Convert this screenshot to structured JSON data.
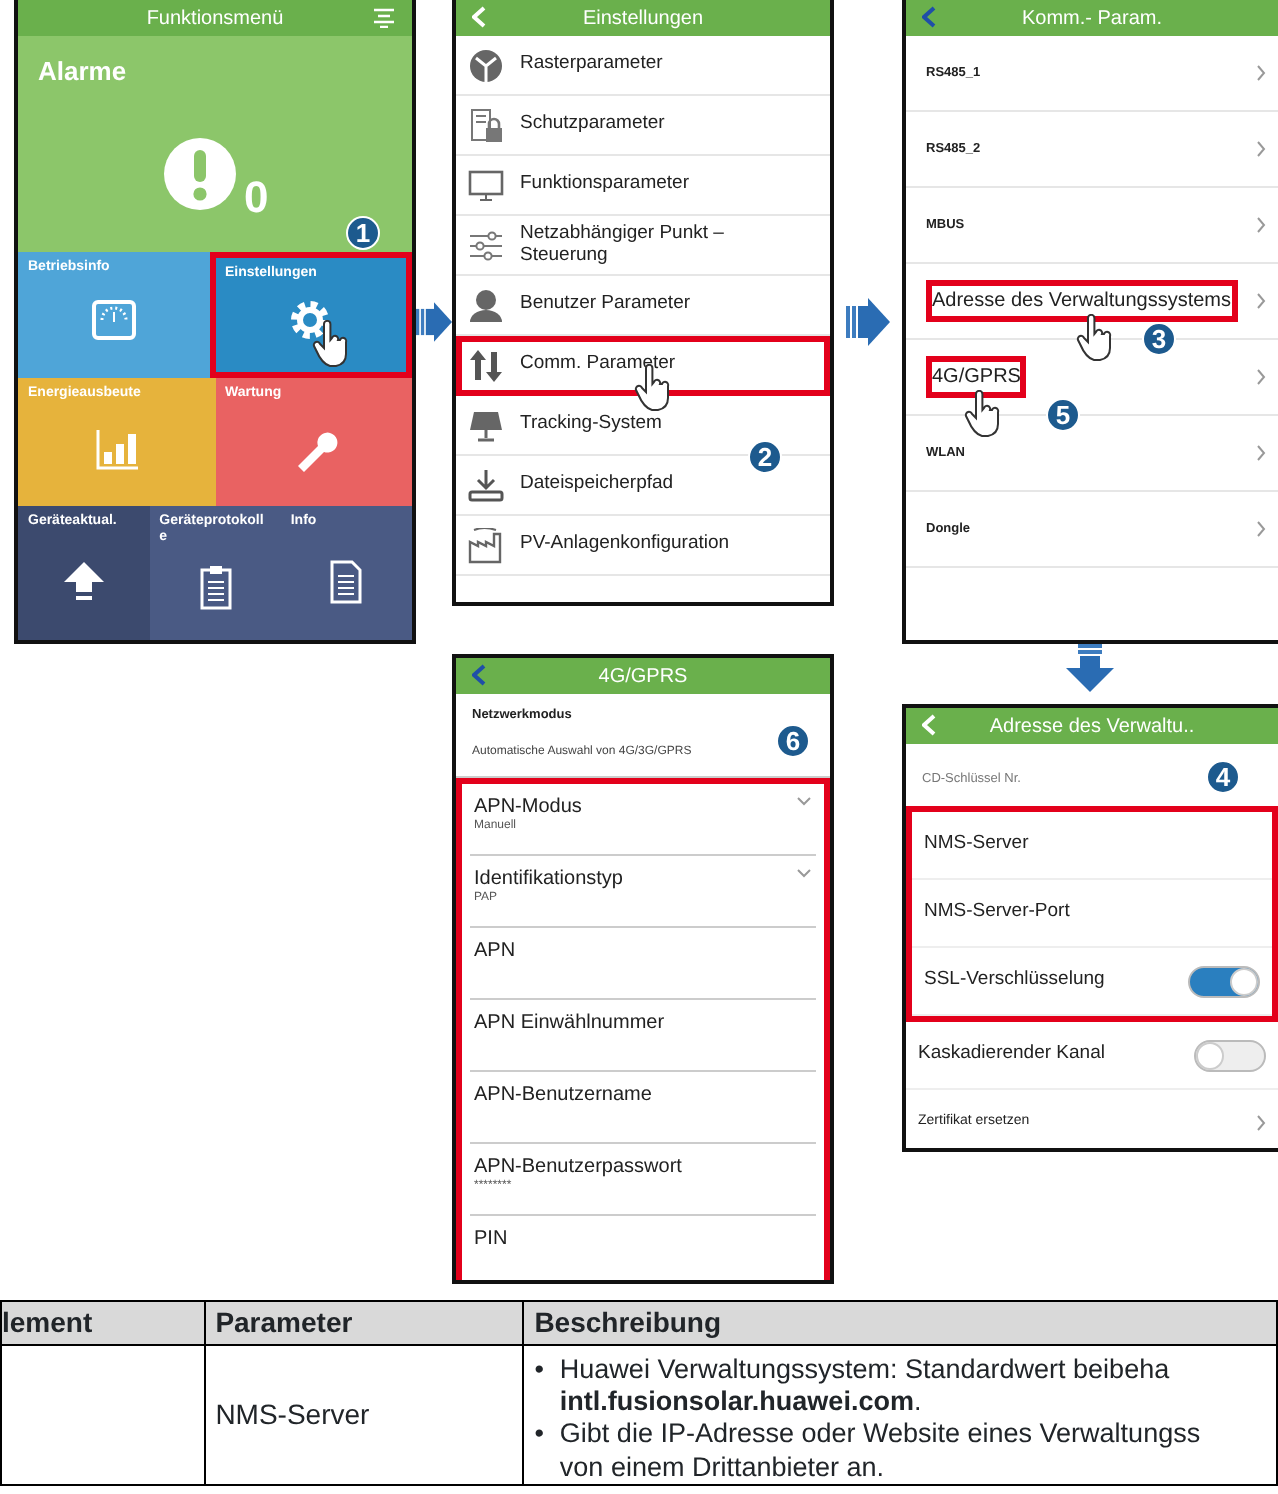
{
  "main_menu": {
    "title": "Funktionsmenü",
    "alarm": {
      "label": "Alarme",
      "count": "0"
    },
    "badge": "1",
    "tile_rows": [
      [
        {
          "label": "Betriebsinfo",
          "color": "#4fa5d8",
          "selected": false
        },
        {
          "label": "Einstellungen",
          "color": "#2a8bc4",
          "selected": true
        }
      ],
      [
        {
          "label": "Energieausbeute",
          "color": "#e6b33c",
          "selected": false
        },
        {
          "label": "Wartung",
          "color": "#e96262",
          "selected": false
        }
      ],
      [
        {
          "label": "Geräteaktual.",
          "color": "#3c4a6e",
          "selected": false
        },
        {
          "label": "Geräteprotokolle",
          "color": "#4a5a84",
          "selected": false
        },
        {
          "label": "Info",
          "color": "#4a5a84",
          "selected": false
        }
      ]
    ]
  },
  "settings": {
    "title": "Einstellungen",
    "badge": "2",
    "items": [
      {
        "label": "Rasterparameter",
        "selected": false
      },
      {
        "label": "Schutzparameter",
        "selected": false
      },
      {
        "label": "Funktionsparameter",
        "selected": false
      },
      {
        "label": "Netzabhängiger Punkt  – Steuerung",
        "selected": false
      },
      {
        "label": "Benutzer Parameter",
        "selected": false
      },
      {
        "label": "Comm. Parameter",
        "selected": true
      },
      {
        "label": "Tracking-System",
        "selected": false
      },
      {
        "label": "Dateispeicherpfad",
        "selected": false
      },
      {
        "label": "PV-Anlagenkonfiguration",
        "selected": false
      }
    ]
  },
  "comm_params": {
    "title": "Komm.- Param.",
    "items": [
      {
        "label": "RS485_1",
        "kind": "small",
        "selected": false
      },
      {
        "label": "RS485_2",
        "kind": "small",
        "selected": false
      },
      {
        "label": "MBUS",
        "kind": "small",
        "selected": false
      },
      {
        "label": "Adresse des Verwaltungssystems",
        "kind": "large",
        "selected": true,
        "badge": "3"
      },
      {
        "label": "4G/GPRS",
        "kind": "large",
        "selected": true,
        "badge": "5"
      },
      {
        "label": "WLAN",
        "kind": "small",
        "selected": false
      },
      {
        "label": "Dongle",
        "kind": "small",
        "selected": false
      }
    ]
  },
  "gprs": {
    "title": "4G/GPRS",
    "network_mode": {
      "label": "Netzwerkmodus",
      "value": "Automatische Auswahl von 4G/3G/GPRS"
    },
    "badge": "6",
    "fields": [
      {
        "label": "APN-Modus",
        "value": "Manuell",
        "kind": "dropdown"
      },
      {
        "label": "Identifikationstyp",
        "value": "PAP",
        "kind": "dropdown"
      },
      {
        "label": "APN",
        "kind": "text"
      },
      {
        "label": "APN Einwählnummer",
        "kind": "text"
      },
      {
        "label": "APN-Benutzername",
        "kind": "text"
      },
      {
        "label": "APN-Benutzerpasswort",
        "value": "********",
        "kind": "text"
      },
      {
        "label": "PIN",
        "kind": "text"
      }
    ]
  },
  "management_address": {
    "title": "Adresse des Verwaltu..",
    "key_label": "CD-Schlüssel Nr.",
    "badge": "4",
    "highlighted": [
      {
        "label": "NMS-Server",
        "kind": "text"
      },
      {
        "label": "NMS-Server-Port",
        "kind": "text"
      },
      {
        "label": "SSL-Verschlüsselung",
        "kind": "toggle",
        "on": true
      }
    ],
    "others": [
      {
        "label": "Kaskadierender Kanal",
        "kind": "toggle",
        "on": false
      },
      {
        "label": "Zertifikat ersetzen",
        "kind": "link"
      }
    ]
  },
  "table": {
    "columns": [
      "lement",
      "Parameter",
      "Beschreibung"
    ],
    "rows": [
      {
        "parameter": "NMS-Server",
        "description": [
          {
            "marker": "•",
            "lines": [
              "Huawei Verwaltungssystem: Standardwert beibeha",
              "**intl.fusionsolar.huawei.com**."
            ]
          },
          {
            "marker": "•",
            "lines": [
              "Gibt die IP-Adresse oder Website eines Verwaltungss",
              "von einem Drittanbieter an."
            ]
          }
        ]
      }
    ]
  }
}
